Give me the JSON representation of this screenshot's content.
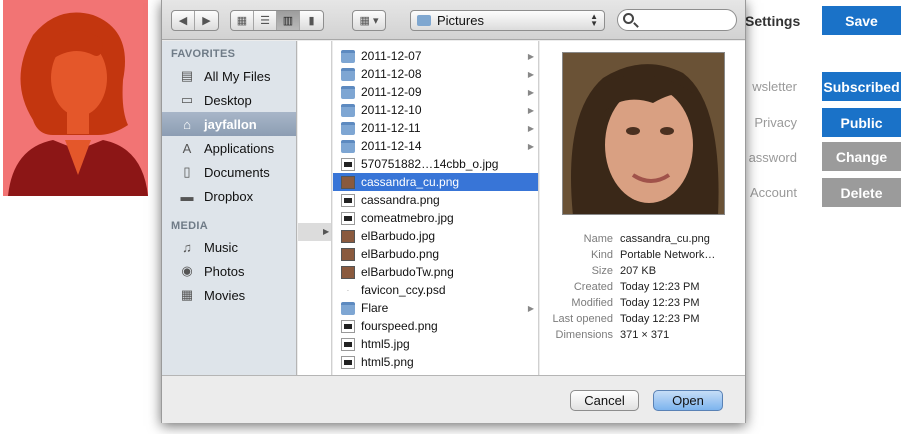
{
  "background": {
    "settings_title": "Settings",
    "save_label": "Save",
    "rows": [
      {
        "label": "wsletter",
        "button": "Subscribed",
        "style": "blue"
      },
      {
        "label": "Privacy",
        "button": "Public",
        "style": "blue"
      },
      {
        "label": "assword",
        "button": "Change",
        "style": "gray"
      },
      {
        "label": "Account",
        "button": "Delete",
        "style": "gray"
      }
    ],
    "accent_color": "#1a72c8",
    "avatar_color": "#f27474"
  },
  "dialog": {
    "location": "Pictures",
    "sidebar": {
      "favorites_header": "FAVORITES",
      "favorites": [
        {
          "label": "All My Files",
          "icon": "all-files-icon",
          "glyph": "▤"
        },
        {
          "label": "Desktop",
          "icon": "desktop-icon",
          "glyph": "▭"
        },
        {
          "label": "jayfallon",
          "icon": "home-icon",
          "glyph": "⌂",
          "selected": true
        },
        {
          "label": "Applications",
          "icon": "applications-icon",
          "glyph": "A"
        },
        {
          "label": "Documents",
          "icon": "documents-icon",
          "glyph": "▯"
        },
        {
          "label": "Dropbox",
          "icon": "folder-icon",
          "glyph": "▬"
        }
      ],
      "media_header": "MEDIA",
      "media": [
        {
          "label": "Music",
          "icon": "music-icon",
          "glyph": "♫"
        },
        {
          "label": "Photos",
          "icon": "camera-icon",
          "glyph": "◉"
        },
        {
          "label": "Movies",
          "icon": "film-icon",
          "glyph": "▦"
        }
      ]
    },
    "files": [
      {
        "name": "2011-12-07",
        "kind": "folder"
      },
      {
        "name": "2011-12-08",
        "kind": "folder"
      },
      {
        "name": "2011-12-09",
        "kind": "folder"
      },
      {
        "name": "2011-12-10",
        "kind": "folder"
      },
      {
        "name": "2011-12-11",
        "kind": "folder"
      },
      {
        "name": "2011-12-14",
        "kind": "folder"
      },
      {
        "name": "570751882…14cbb_o.jpg",
        "kind": "img"
      },
      {
        "name": "cassandra_cu.png",
        "kind": "thumb",
        "selected": true
      },
      {
        "name": "cassandra.png",
        "kind": "img"
      },
      {
        "name": "comeatmebro.jpg",
        "kind": "img"
      },
      {
        "name": "elBarbudo.jpg",
        "kind": "thumb"
      },
      {
        "name": "elBarbudo.png",
        "kind": "thumb"
      },
      {
        "name": "elBarbudoTw.png",
        "kind": "thumb"
      },
      {
        "name": "favicon_ccy.psd",
        "kind": "psd"
      },
      {
        "name": "Flare",
        "kind": "folder"
      },
      {
        "name": "fourspeed.png",
        "kind": "img"
      },
      {
        "name": "html5.jpg",
        "kind": "img"
      },
      {
        "name": "html5.png",
        "kind": "img"
      }
    ],
    "info": [
      {
        "key": "Name",
        "value": "cassandra_cu.png"
      },
      {
        "key": "Kind",
        "value": "Portable Network…"
      },
      {
        "key": "Size",
        "value": "207 KB"
      },
      {
        "key": "Created",
        "value": "Today 12:23 PM"
      },
      {
        "key": "Modified",
        "value": "Today 12:23 PM"
      },
      {
        "key": "Last opened",
        "value": "Today 12:23 PM"
      },
      {
        "key": "Dimensions",
        "value": "371 × 371"
      }
    ],
    "cancel_label": "Cancel",
    "open_label": "Open"
  }
}
